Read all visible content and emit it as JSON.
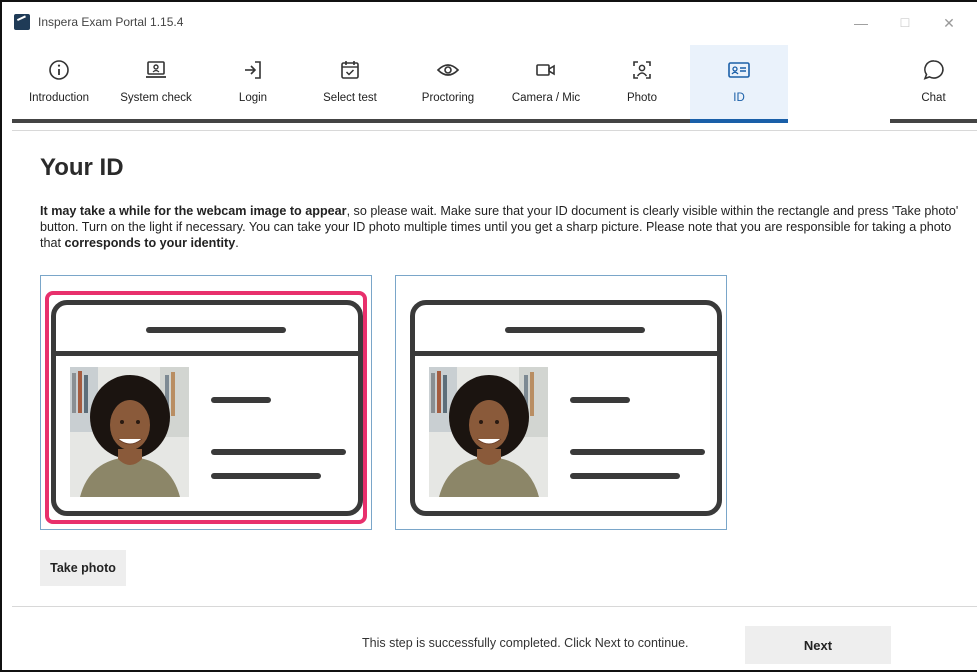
{
  "window": {
    "title": "Inspera Exam Portal 1.15.4",
    "controls": {
      "minimize": "—",
      "maximize": "☐",
      "close": "✕"
    }
  },
  "steps": [
    {
      "label": "Introduction",
      "icon": "info-icon",
      "state": "done"
    },
    {
      "label": "System check",
      "icon": "laptop-icon",
      "state": "done"
    },
    {
      "label": "Login",
      "icon": "login-icon",
      "state": "done"
    },
    {
      "label": "Select test",
      "icon": "calendar-check-icon",
      "state": "done"
    },
    {
      "label": "Proctoring",
      "icon": "eye-icon",
      "state": "done"
    },
    {
      "label": "Camera / Mic",
      "icon": "video-camera-icon",
      "state": "done"
    },
    {
      "label": "Photo",
      "icon": "face-scan-icon",
      "state": "done"
    },
    {
      "label": "ID",
      "icon": "id-card-icon",
      "state": "active"
    },
    {
      "label": "Chat",
      "icon": "chat-bubble-icon",
      "state": "available"
    }
  ],
  "main": {
    "heading": "Your ID",
    "instructions": {
      "bold1": "It may take a while for the webcam image to appear",
      "text1": ", so please wait. Make sure that your ID document is clearly visible within the rectangle and press 'Take photo' button. Turn on the light if necessary. You can take your ID photo multiple times until you get a sharp picture. Please note that you are responsible for taking a photo that ",
      "bold2": "corresponds to your identity",
      "text2": "."
    },
    "take_photo_label": "Take photo"
  },
  "footer": {
    "status": "This step is successfully completed. Click Next to continue.",
    "next_label": "Next"
  },
  "colors": {
    "active_tab_bg": "#eaf2fb",
    "active_accent": "#1a5fa8",
    "capture_frame": "#e8306c",
    "panel_border": "#7aa6c9"
  }
}
